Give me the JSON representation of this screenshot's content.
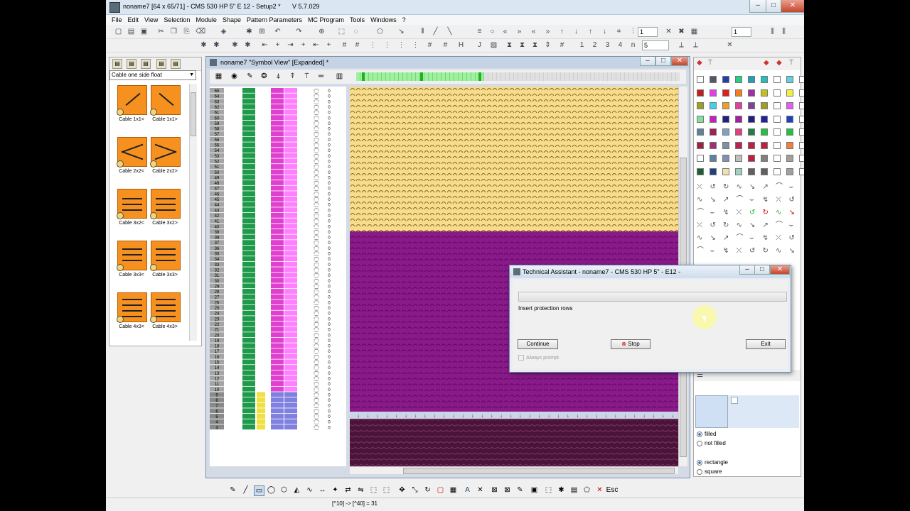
{
  "window": {
    "title": "noname7 [64 x 65/71] - CMS 530 HP 5\" E 12 - Setup2 *",
    "version": "V 5.7.029"
  },
  "menu": [
    "File",
    "Edit",
    "View",
    "Selection",
    "Module",
    "Shape",
    "Pattern Parameters",
    "MC Program",
    "Tools",
    "Windows",
    "?"
  ],
  "toolbar": {
    "field1": "1",
    "field2": "1",
    "field3": "5",
    "field4": "1"
  },
  "toolbar2": {
    "digits": [
      "1",
      "2",
      "3",
      "4",
      "n"
    ]
  },
  "left_panel": {
    "dropdown": "Cable one side float",
    "tiles": [
      "Cable 1x1<",
      "Cable 1x1>",
      "Cable 2x2<",
      "Cable 2x2>",
      "Cable 3x2<",
      "Cable 3x2>",
      "Cable 3x3<",
      "Cable 3x3>",
      "Cable 4x3<",
      "Cable 4x3>"
    ]
  },
  "symbol_view": {
    "title": "noname7 \"Symbol View\" [Expanded] *",
    "row_numbers": [
      "65",
      "64",
      "63",
      "62",
      "61",
      "60",
      "59",
      "58",
      "57",
      "56",
      "55",
      "54",
      "53",
      "52",
      "51",
      "50",
      "49",
      "48",
      "47",
      "46",
      "45",
      "44",
      "43",
      "42",
      "41",
      "40",
      "39",
      "38",
      "37",
      "36",
      "35",
      "34",
      "33",
      "32",
      "31",
      "30",
      "29",
      "28",
      "27",
      "26",
      "25",
      "24",
      "23",
      "22",
      "21",
      "20",
      "19",
      "18",
      "17",
      "16",
      "15",
      "14",
      "13",
      "12",
      "11",
      "10",
      "9",
      "8",
      "7",
      "6",
      "5",
      "4",
      "3"
    ],
    "col_value": "0"
  },
  "dialog": {
    "title": "Technical Assistant - noname7 - CMS 530 HP 5\" - E12 -",
    "message": "Insert protection rows",
    "continue": "Continue",
    "stop": "Stop",
    "exit": "Exit",
    "always_prompt": "Always prompt"
  },
  "right_panel": {
    "fill_options": [
      "filled",
      "not filled"
    ],
    "shape_options": [
      "rectangle",
      "square"
    ]
  },
  "status": {
    "text": "[^10] -> [^40] = 31"
  },
  "colors": {
    "yellow": "#f6dc8c",
    "purple": "#8a1a8a",
    "dark": "#4a1438",
    "green": "#1f9a4a",
    "magenta": "#e040d0",
    "pink": "#ff80ff"
  }
}
